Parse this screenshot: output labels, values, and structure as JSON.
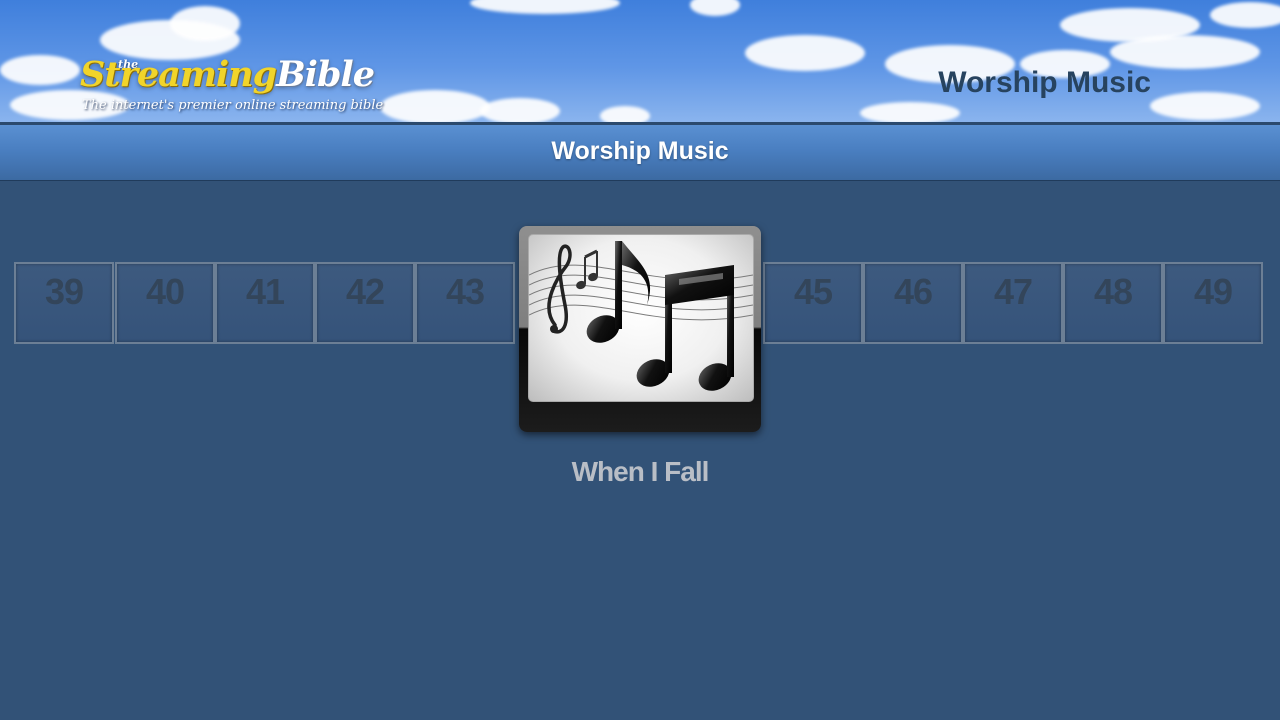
{
  "header": {
    "logo": {
      "prefix": "the",
      "word_streaming": "Streaming",
      "word_bible": "Bible",
      "tagline": "The internet's premier online streaming bible"
    },
    "title": "Worship Music"
  },
  "title_bar": {
    "text": "Worship Music"
  },
  "carousel": {
    "tracks_before": [
      "39",
      "40",
      "41",
      "42",
      "43"
    ],
    "tracks_after": [
      "45",
      "46",
      "47",
      "48",
      "49"
    ],
    "selected": {
      "art_icon": "music-notes-icon",
      "title": "When I Fall"
    }
  },
  "colors": {
    "background": "#325277",
    "title_bar": "#4a7fc1",
    "tile_number": "#33455a",
    "logo_yellow": "#f1d42a"
  }
}
